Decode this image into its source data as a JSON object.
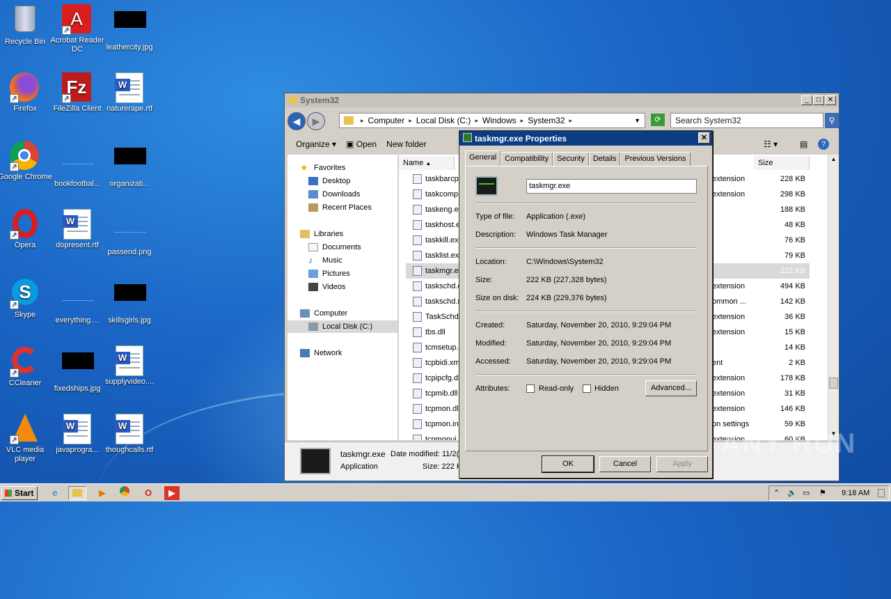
{
  "desktop": {
    "icons": [
      {
        "label": "Recycle Bin",
        "icon": "recycle-bin-icon"
      },
      {
        "label": "Acrobat Reader DC",
        "icon": "acrobat-icon"
      },
      {
        "label": "leathercity.jpg",
        "icon": "image-file-icon"
      },
      {
        "label": "Firefox",
        "icon": "firefox-icon"
      },
      {
        "label": "FileZilla Client",
        "icon": "filezilla-icon"
      },
      {
        "label": "naturerape.rtf",
        "icon": "word-doc-icon"
      },
      {
        "label": "Google Chrome",
        "icon": "chrome-icon"
      },
      {
        "label": "bookfootbal...",
        "icon": "blank-file-icon"
      },
      {
        "label": "organizati...",
        "icon": "image-file-icon"
      },
      {
        "label": "Opera",
        "icon": "opera-icon"
      },
      {
        "label": "dopresent.rtf",
        "icon": "word-doc-icon"
      },
      {
        "label": "passend.png",
        "icon": "blank-file-icon"
      },
      {
        "label": "Skype",
        "icon": "skype-icon"
      },
      {
        "label": "everything....",
        "icon": "blank-file-icon"
      },
      {
        "label": "skillsgirls.jpg",
        "icon": "image-file-icon"
      },
      {
        "label": "CCleaner",
        "icon": "ccleaner-icon"
      },
      {
        "label": "fixedships.jpg",
        "icon": "image-file-icon"
      },
      {
        "label": "supplyvideo....",
        "icon": "word-doc-icon"
      },
      {
        "label": "VLC media player",
        "icon": "vlc-icon"
      },
      {
        "label": "javaprogra...",
        "icon": "word-doc-icon"
      },
      {
        "label": "thoughcalls.rtf",
        "icon": "word-doc-icon"
      }
    ]
  },
  "explorer": {
    "title": "System32",
    "breadcrumb": [
      "Computer",
      "Local Disk (C:)",
      "Windows",
      "System32"
    ],
    "search_placeholder": "Search System32",
    "toolbar": {
      "organize": "Organize",
      "open": "Open",
      "new_folder": "New folder"
    },
    "nav": {
      "favorites": "Favorites",
      "desktop": "Desktop",
      "downloads": "Downloads",
      "recent": "Recent Places",
      "libraries": "Libraries",
      "documents": "Documents",
      "music": "Music",
      "pictures": "Pictures",
      "videos": "Videos",
      "computer": "Computer",
      "local_disk": "Local Disk (C:)",
      "network": "Network"
    },
    "columns": {
      "name": "Name",
      "size": "Size"
    },
    "files": [
      {
        "name": "taskbarcpl",
        "type": "extension",
        "size": "228 KB"
      },
      {
        "name": "taskcomp.",
        "type": "extension",
        "size": "298 KB"
      },
      {
        "name": "taskeng.ex",
        "type": "",
        "size": "188 KB"
      },
      {
        "name": "taskhost.e",
        "type": "",
        "size": "48 KB"
      },
      {
        "name": "taskkill.exe",
        "type": "",
        "size": "76 KB"
      },
      {
        "name": "tasklist.ex",
        "type": "",
        "size": "79 KB"
      },
      {
        "name": "taskmgr.ex",
        "type": "",
        "size": "222 KB"
      },
      {
        "name": "taskschd.c",
        "type": "extension",
        "size": "494 KB"
      },
      {
        "name": "taskschd.r",
        "type": "ommon ...",
        "size": "142 KB"
      },
      {
        "name": "TaskSchdP",
        "type": "extension",
        "size": "36 KB"
      },
      {
        "name": "tbs.dll",
        "type": "extension",
        "size": "15 KB"
      },
      {
        "name": "tcmsetup.e",
        "type": "",
        "size": "14 KB"
      },
      {
        "name": "tcpbidi.xm",
        "type": "ent",
        "size": "2 KB"
      },
      {
        "name": "tcpipcfg.dl",
        "type": "extension",
        "size": "178 KB"
      },
      {
        "name": "tcpmib.dll",
        "type": "extension",
        "size": "31 KB"
      },
      {
        "name": "tcpmon.dll",
        "type": "extension",
        "size": "146 KB"
      },
      {
        "name": "tcpmon.ini",
        "type": "on settings",
        "size": "59 KB"
      },
      {
        "name": "tcpmonui.",
        "type": "extension",
        "size": "60 KB"
      }
    ],
    "details": {
      "filename": "taskmgr.exe",
      "date_label": "Date modified: 11/2(",
      "type": "Application",
      "size_label": "Size: 222 K"
    }
  },
  "dialog": {
    "title": "taskmgr.exe Properties",
    "tabs": [
      "General",
      "Compatibility",
      "Security",
      "Details",
      "Previous Versions"
    ],
    "filename": "taskmgr.exe",
    "labels": {
      "type": "Type of file:",
      "description": "Description:",
      "location": "Location:",
      "size": "Size:",
      "size_on_disk": "Size on disk:",
      "created": "Created:",
      "modified": "Modified:",
      "accessed": "Accessed:",
      "attributes": "Attributes:"
    },
    "values": {
      "type": "Application (.exe)",
      "description": "Windows Task Manager",
      "location": "C:\\Windows\\System32",
      "size": "222 KB (227,328 bytes)",
      "size_on_disk": "224 KB (229,376 bytes)",
      "created": "Saturday, November 20, 2010, 9:29:04 PM",
      "modified": "Saturday, November 20, 2010, 9:29:04 PM",
      "accessed": "Saturday, November 20, 2010, 9:29:04 PM"
    },
    "readonly_label": "Read-only",
    "hidden_label": "Hidden",
    "advanced_label": "Advanced...",
    "ok_label": "OK",
    "cancel_label": "Cancel",
    "apply_label": "Apply"
  },
  "taskbar": {
    "start_label": "Start",
    "clock": "9:18 AM"
  },
  "watermark": "ANY RUN"
}
